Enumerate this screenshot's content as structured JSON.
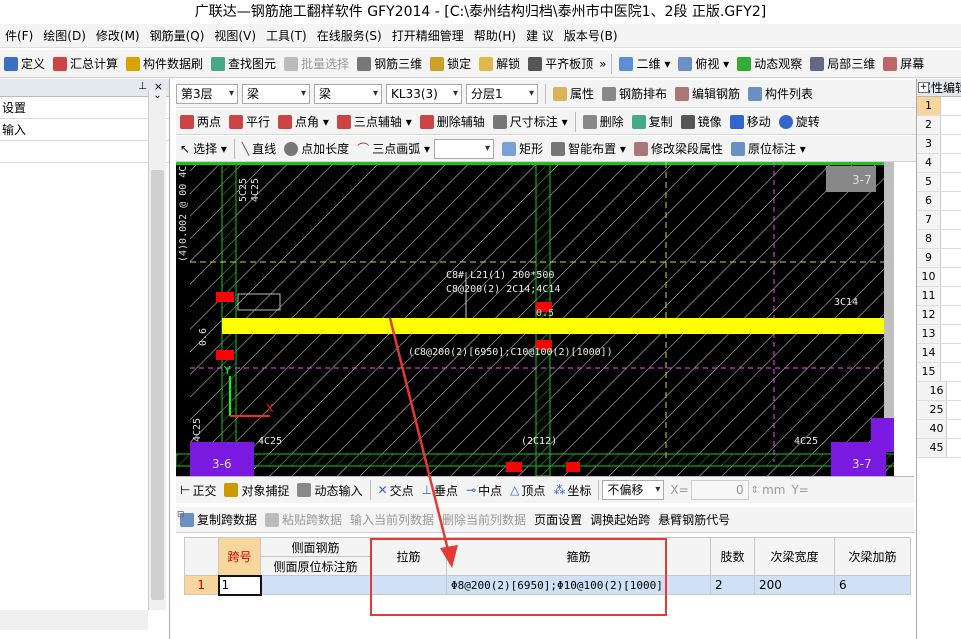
{
  "window": {
    "title": "广联达—钢筋施工翻样软件 GFY2014 - [C:\\泰州结构归档\\泰州市中医院1、2段 正版.GFY2]"
  },
  "menu": [
    "件(F)",
    "绘图(D)",
    "修改(M)",
    "钢筋量(Q)",
    "视图(V)",
    "工具(T)",
    "在线服务(S)",
    "打开精细管理",
    "帮助(H)",
    "建 议",
    "版本号(B)"
  ],
  "toolbar1": {
    "items": [
      "定义",
      "汇总计算",
      "构件数据刷",
      "查找图元",
      "批量选择",
      "钢筋三维",
      "锁定",
      "解锁",
      "平齐板顶"
    ],
    "view_select": "二维",
    "right_items": [
      "俯视",
      "动态观察",
      "局部三维",
      "屏幕"
    ]
  },
  "left_panel": {
    "rows": [
      "设置",
      "输入"
    ]
  },
  "selectors": {
    "floor": "第3层",
    "category": "梁",
    "type": "梁",
    "element": "KL33(3)",
    "layer": "分层1"
  },
  "toolbar_top_right": [
    "属性",
    "钢筋排布",
    "编辑钢筋",
    "构件列表"
  ],
  "toolbar2": [
    "两点",
    "平行",
    "点角",
    "三点辅轴",
    "删除辅轴",
    "尺寸标注",
    "删除",
    "复制",
    "镜像",
    "移动",
    "旋转"
  ],
  "toolbar3": [
    "选择",
    "直线",
    "点加长度",
    "三点画弧",
    "矩形",
    "智能布置",
    "修改梁段属性",
    "原位标注"
  ],
  "canvas": {
    "labels": {
      "top_left_vertical": "(4)0.002 @ 00 4C",
      "col_top": "5C25",
      "col_top2": "4C25",
      "beam_l21_line1": "C8#  L21(1) 200*500",
      "beam_l21_line2": "C8@200(2) 2C14;4C14",
      "right_rebar": "3C14",
      "main_annot": "(C8@200(2)[6950];C10@100(2)[1000])",
      "bottom_left": "4C25",
      "bottom_right": "4C25",
      "bottom_mid": "(2C12)",
      "left_vertical": "4C25",
      "grid_left": "3-6",
      "grid_right": "3-7",
      "grid_top_right": "3-7",
      "depth": "0.6",
      "depth2": "0.5"
    }
  },
  "snapbar": {
    "items": [
      "正交",
      "对象捕捉",
      "动态输入",
      "交点",
      "垂点",
      "中点",
      "顶点",
      "坐标"
    ],
    "offset_mode": "不偏移",
    "x_label": "X=",
    "x_value": "0",
    "unit": "mm",
    "y_label": "Y="
  },
  "spanbar": [
    "复制跨数据",
    "粘贴跨数据",
    "输入当前列数据",
    "删除当前列数据",
    "页面设置",
    "调换起始跨",
    "悬臂钢筋代号"
  ],
  "table": {
    "headers": {
      "span": "跨号",
      "side_rebar": "侧面钢筋",
      "side_original": "侧面原位标注筋",
      "tie": "拉筋",
      "stirrup": "箍筋",
      "legs": "肢数",
      "sub_width": "次梁宽度",
      "sub_add": "次梁加筋"
    },
    "rows": [
      {
        "idx": "1",
        "span": "1",
        "side_original": "",
        "tie": "",
        "stirrup": "Φ8@200(2)[6950];Φ10@100(2)[1000]",
        "legs": "2",
        "sub_width": "200",
        "sub_add": "6"
      }
    ]
  },
  "right_panel": {
    "title": "属性编辑",
    "rows": [
      "1",
      "2",
      "3",
      "4",
      "5",
      "6",
      "7",
      "8",
      "9",
      "10",
      "11",
      "12",
      "13",
      "14",
      "15",
      "16",
      "25",
      "40",
      "45"
    ]
  },
  "colors": {
    "beam": "#ffff00",
    "grid_lines": "#00cc00",
    "axis_dashed": "#ff44ff",
    "rebar_mark": "#ff0000",
    "highlight": "#e53935",
    "purple_col": "#7a1ae0"
  }
}
